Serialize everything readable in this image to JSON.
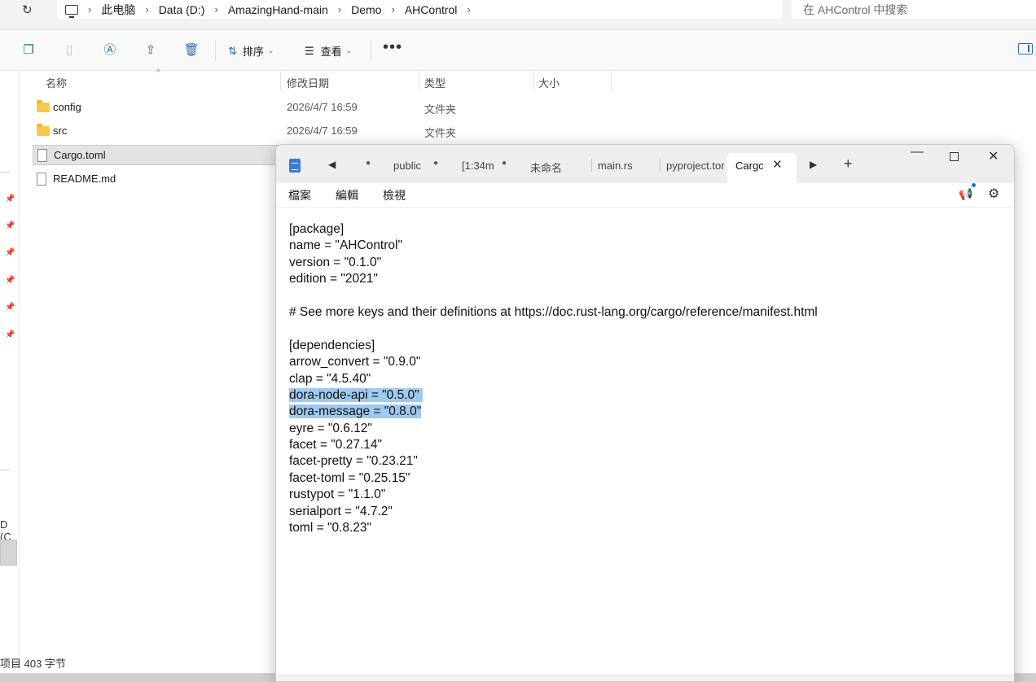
{
  "explorer": {
    "breadcrumbs": [
      "此电脑",
      "Data (D:)",
      "AmazingHand-main",
      "Demo",
      "AHControl"
    ],
    "search_placeholder": "在 AHControl 中搜索",
    "toolbar": {
      "sort_label": "排序",
      "view_label": "查看"
    },
    "columns": {
      "name": "名称",
      "date": "修改日期",
      "type": "类型",
      "size": "大小"
    },
    "files": [
      {
        "name": "config",
        "date": "2026/4/7 16:59",
        "type": "文件夹",
        "icon": "folder-icon"
      },
      {
        "name": "src",
        "date": "2026/4/7 16:59",
        "type": "文件夹",
        "icon": "folder-icon"
      },
      {
        "name": "Cargo.toml",
        "date": "",
        "type": "",
        "icon": "file-icon"
      },
      {
        "name": "README.md",
        "date": "",
        "type": "",
        "icon": "file-icon"
      }
    ],
    "nav_partial_text": "D (C",
    "status_text": "项目  403 字节"
  },
  "notepad": {
    "tabs": [
      "public",
      "[1:34m",
      "未命名",
      "main.rs",
      "pyproject.tor"
    ],
    "active_tab": "Cargc",
    "menu": [
      "檔案",
      "編輯",
      "檢視"
    ],
    "content": [
      {
        "text": "[package]",
        "hl": false
      },
      {
        "text": "name = \"AHControl\"",
        "hl": false
      },
      {
        "text": "version = \"0.1.0\"",
        "hl": false
      },
      {
        "text": "edition = \"2021\"",
        "hl": false
      },
      {
        "text": "",
        "hl": false
      },
      {
        "text": "# See more keys and their definitions at https://doc.rust-lang.org/cargo/reference/manifest.html",
        "hl": false
      },
      {
        "text": "",
        "hl": false
      },
      {
        "text": "[dependencies]",
        "hl": false
      },
      {
        "text": "arrow_convert = \"0.9.0\"",
        "hl": false
      },
      {
        "text": "clap = \"4.5.40\"",
        "hl": false
      },
      {
        "text": "dora-node-api = \"0.5.0\" ",
        "hl": true
      },
      {
        "text": "dora-message = \"0.8.0\"",
        "hl": true
      },
      {
        "text": "eyre = \"0.6.12\"",
        "hl": false
      },
      {
        "text": "facet = \"0.27.14\"",
        "hl": false
      },
      {
        "text": "facet-pretty = \"0.23.21\"",
        "hl": false
      },
      {
        "text": "facet-toml = \"0.25.15\"",
        "hl": false
      },
      {
        "text": "rustypot = \"1.1.0\"",
        "hl": false
      },
      {
        "text": "serialport = \"4.7.2\"",
        "hl": false
      },
      {
        "text": "toml = \"0.8.23\"",
        "hl": false
      }
    ]
  }
}
